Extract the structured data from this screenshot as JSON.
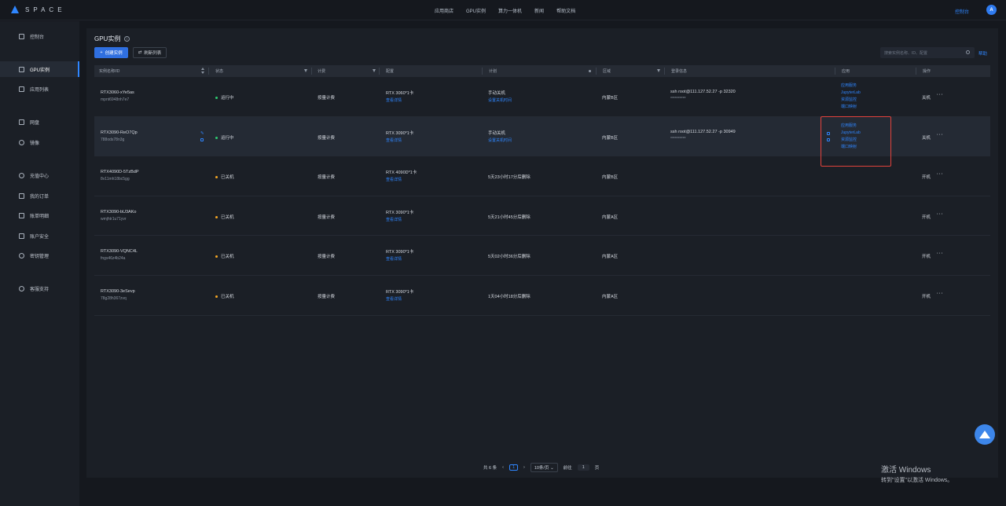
{
  "brand": {
    "name": "SPACE"
  },
  "topnav": [
    "应用商店",
    "GPU实例",
    "算力一体机",
    "新闻",
    "帮助文档"
  ],
  "top_console": "控制台",
  "avatar_letter": "A",
  "sidebar": [
    {
      "label": "控制台",
      "icon": "dashboard-icon"
    },
    {
      "label": "GPU实例",
      "icon": "gpu-icon",
      "active": true
    },
    {
      "label": "应用列表",
      "icon": "cube-icon"
    },
    {
      "label": "网盘",
      "icon": "disk-icon"
    },
    {
      "label": "镜像",
      "icon": "image-icon"
    },
    {
      "label": "充值中心",
      "icon": "recharge-icon"
    },
    {
      "label": "我的订单",
      "icon": "order-icon"
    },
    {
      "label": "账单明细",
      "icon": "bill-icon"
    },
    {
      "label": "账户安全",
      "icon": "shield-icon"
    },
    {
      "label": "密钥管理",
      "icon": "key-icon"
    },
    {
      "label": "客服支持",
      "icon": "chat-icon"
    }
  ],
  "page": {
    "title": "GPU实例",
    "create_btn": "创建实例",
    "refresh_btn": "刷新列表",
    "search_placeholder": "搜索实例名称、ID、配置",
    "help": "帮助"
  },
  "columns": [
    "实例名称/ID",
    "状态",
    "计费",
    "配置",
    "计划",
    "区域",
    "登录信息",
    "应用",
    "操作"
  ],
  "rows": [
    {
      "name": "RTX3060-xYe5as",
      "id": "mpnt6948nh7e7",
      "status": "运行中",
      "status_color": "#2ecc71",
      "billing": "按量计费",
      "config": "RTX 3060*1卡",
      "config_link": "查看详情",
      "plan": "手动关机",
      "plan_link": "设置关机时间",
      "region": "内蒙B区",
      "login": "ssh root@111.127.52.27 -p 32320",
      "password": "**********",
      "apps": [
        "应用服务",
        "JupyterLab",
        "资源监控",
        "端口映射"
      ],
      "action": "关机"
    },
    {
      "name": "RTX3090-ReO7Qp",
      "id": "788ods78n3g",
      "status": "运行中",
      "status_color": "#2ecc71",
      "billing": "按量计费",
      "config": "RTX 3090*1卡",
      "config_link": "查看详情",
      "plan": "手动关机",
      "plan_link": "设置关机时间",
      "region": "内蒙B区",
      "login": "ssh root@111.127.52.27 -p 30949",
      "password": "**********",
      "apps": [
        "应用服务",
        "JupyterLab",
        "资源监控",
        "端口映射"
      ],
      "action": "关机"
    },
    {
      "name": "RTX4090D-5TzBdP",
      "id": "8v11mh18bc5gg",
      "status": "已关机",
      "status_color": "#f5a623",
      "billing": "按量计费",
      "config": "RTX 4090D*1卡",
      "config_link": "查看详情",
      "plan": "5天23小时17分后删除",
      "plan_link": "",
      "region": "内蒙B区",
      "login": "",
      "password": "",
      "apps": [],
      "action": "开机"
    },
    {
      "name": "RTX3090-bU3AKo",
      "id": "wmjhtr1u71yvr",
      "status": "已关机",
      "status_color": "#f5a623",
      "billing": "按量计费",
      "config": "RTX 3090*1卡",
      "config_link": "查看详情",
      "plan": "5天21小时45分后删除",
      "plan_link": "",
      "region": "内蒙A区",
      "login": "",
      "password": "",
      "apps": [],
      "action": "开机"
    },
    {
      "name": "RTX3090-VQNC4L",
      "id": "fngs46z4b24a",
      "status": "已关机",
      "status_color": "#f5a623",
      "billing": "按量计费",
      "config": "RTX 3090*1卡",
      "config_link": "查看详情",
      "plan": "5天02小时36分后删除",
      "plan_link": "",
      "region": "内蒙A区",
      "login": "",
      "password": "",
      "apps": [],
      "action": "开机"
    },
    {
      "name": "RTX3090-3eSevp",
      "id": "78g28h367zvq",
      "status": "已关机",
      "status_color": "#f5a623",
      "billing": "按量计费",
      "config": "RTX 3090*1卡",
      "config_link": "查看详情",
      "plan": "1天04小时18分后删除",
      "plan_link": "",
      "region": "内蒙A区",
      "login": "",
      "password": "",
      "apps": [],
      "action": "开机"
    }
  ],
  "pagination": {
    "total": "共 6 条",
    "current": "1",
    "page_size": "10条/页",
    "goto_label": "前往",
    "goto_value": "1",
    "page_suffix": "页"
  },
  "watermark": {
    "line1": "激活 Windows",
    "line2": "转到\"设置\"以激活 Windows。"
  }
}
